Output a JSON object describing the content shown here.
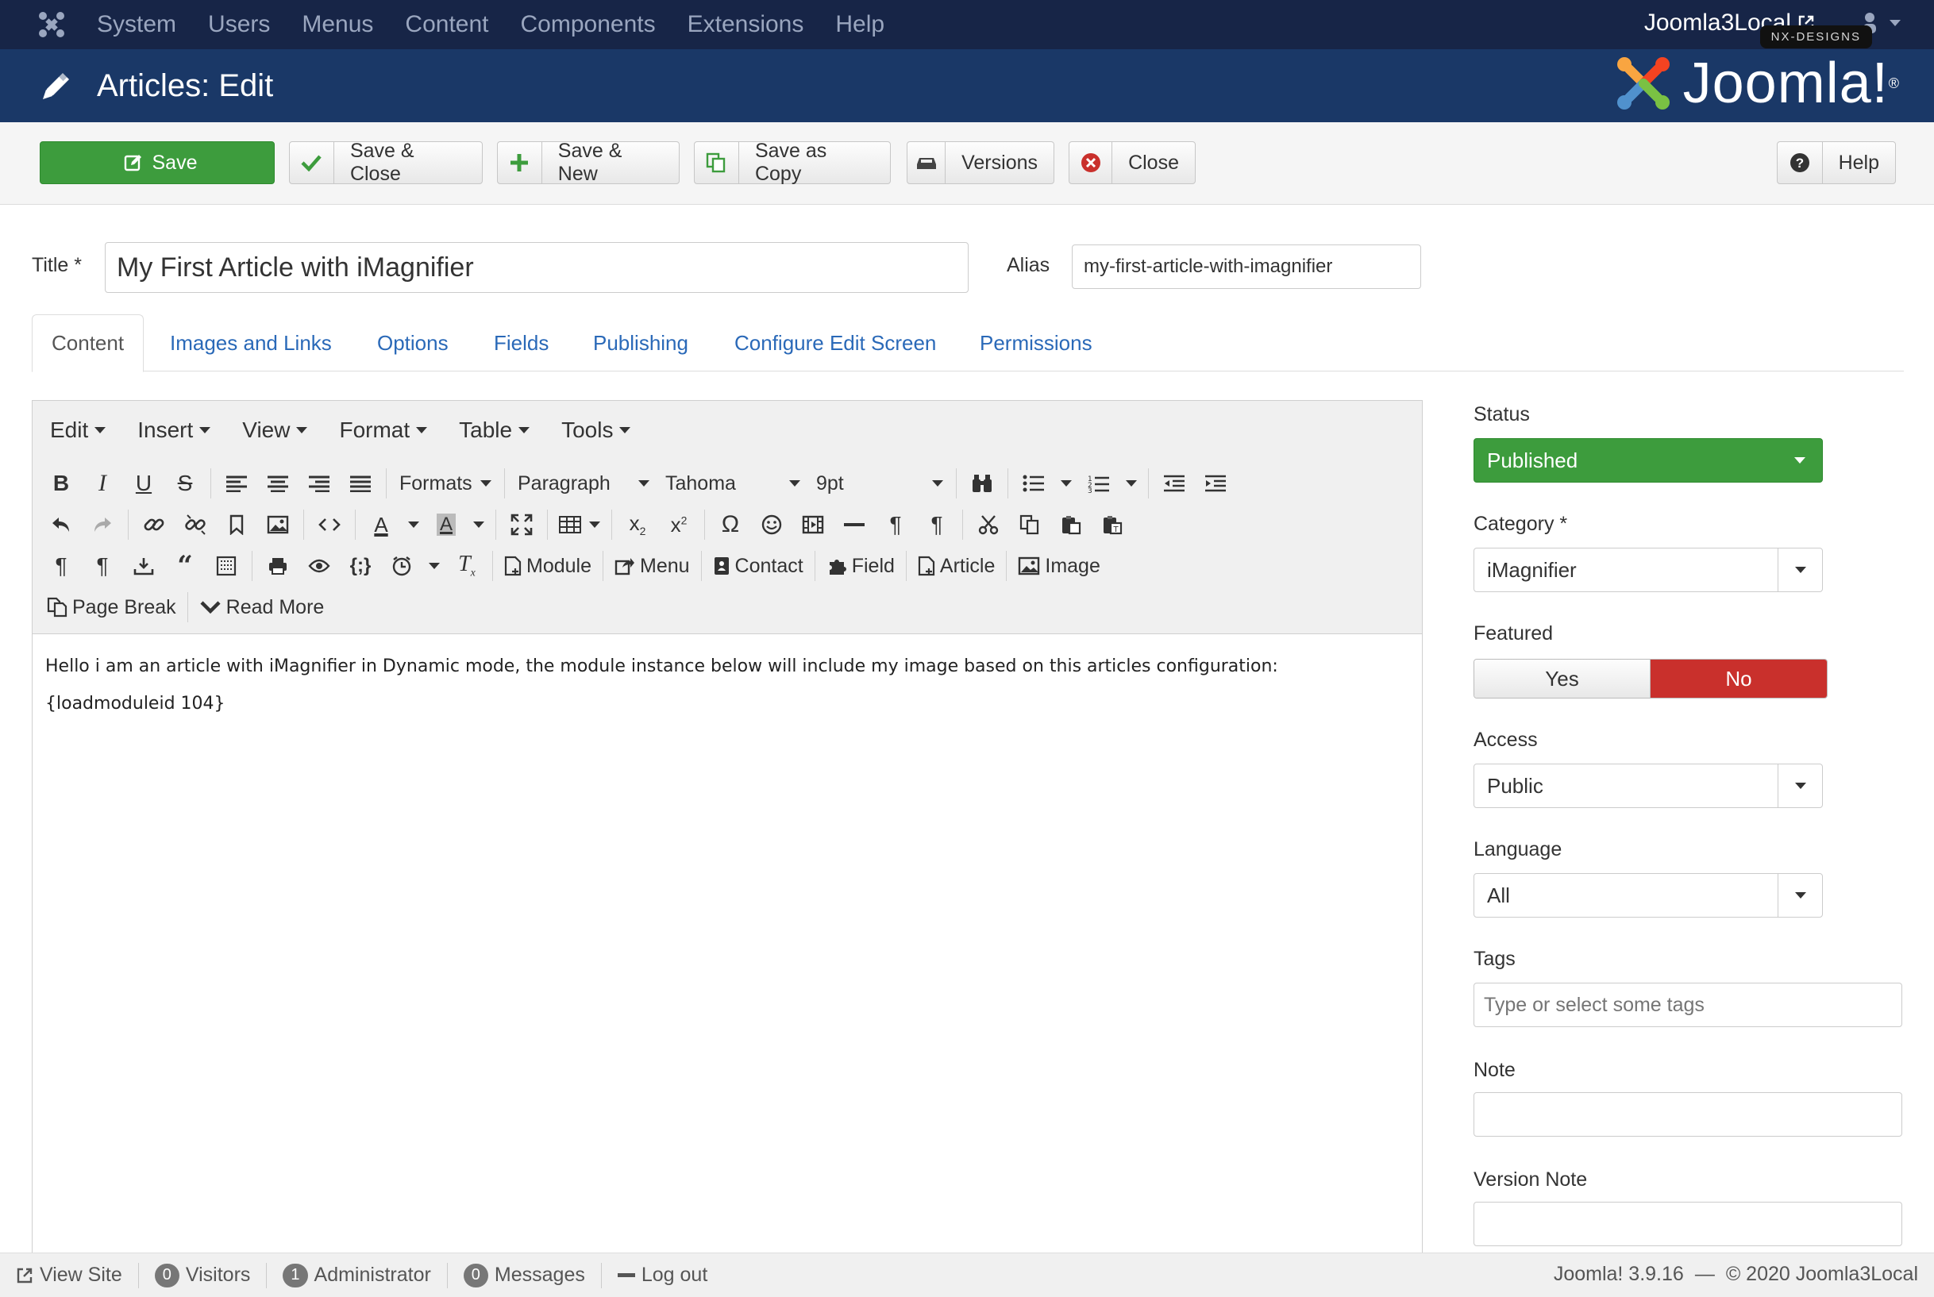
{
  "topnav": {
    "items": [
      "System",
      "Users",
      "Menus",
      "Content",
      "Components",
      "Extensions",
      "Help"
    ],
    "site_name": "Joomla3Local",
    "badge": "NX-DESIGNS"
  },
  "header": {
    "title": "Articles: Edit",
    "brand": "Joomla!",
    "brand_mark": "®"
  },
  "toolbar": {
    "save": "Save",
    "save_close": "Save & Close",
    "save_new": "Save & New",
    "save_copy": "Save as Copy",
    "versions": "Versions",
    "close": "Close",
    "help": "Help"
  },
  "form": {
    "title_label": "Title *",
    "title_value": "My First Article with iMagnifier",
    "alias_label": "Alias",
    "alias_value": "my-first-article-with-imagnifier"
  },
  "tabs": [
    "Content",
    "Images and Links",
    "Options",
    "Fields",
    "Publishing",
    "Configure Edit Screen",
    "Permissions"
  ],
  "editor": {
    "menus": [
      "Edit",
      "Insert",
      "View",
      "Format",
      "Table",
      "Tools"
    ],
    "formats": "Formats",
    "block": "Paragraph",
    "font": "Tahoma",
    "size": "9pt",
    "buttons": {
      "module": "Module",
      "menu": "Menu",
      "contact": "Contact",
      "field": "Field",
      "article": "Article",
      "image": "Image",
      "page_break": "Page Break",
      "read_more": "Read More"
    },
    "paragraphs": [
      "Hello i am an article with iMagnifier in Dynamic mode, the module instance below will include my image based on this articles configuration:",
      "{loadmoduleid 104}"
    ]
  },
  "sidebar": {
    "status_label": "Status",
    "status_value": "Published",
    "category_label": "Category *",
    "category_value": "iMagnifier",
    "featured_label": "Featured",
    "featured_yes": "Yes",
    "featured_no": "No",
    "access_label": "Access",
    "access_value": "Public",
    "language_label": "Language",
    "language_value": "All",
    "tags_label": "Tags",
    "tags_placeholder": "Type or select some tags",
    "note_label": "Note",
    "version_note_label": "Version Note"
  },
  "statusbar": {
    "view_site": "View Site",
    "visitors_count": "0",
    "visitors": "Visitors",
    "admin_count": "1",
    "admin": "Administrator",
    "messages_count": "0",
    "messages": "Messages",
    "logout": "Log out",
    "version": "Joomla! 3.9.16",
    "dash": "—",
    "copyright": "© 2020 Joomla3Local"
  },
  "colors": {
    "nav": "#172547",
    "header": "#1a3867",
    "success": "#3d9c3d",
    "danger": "#c9302c",
    "link": "#2a69b8"
  }
}
